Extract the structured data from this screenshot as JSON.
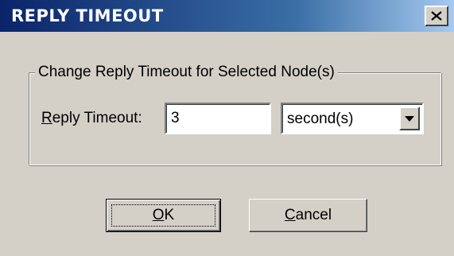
{
  "window": {
    "title": "REPLY TIMEOUT",
    "close_icon": "close-icon"
  },
  "group": {
    "legend": "Change Reply Timeout for Selected Node(s)"
  },
  "reply_timeout": {
    "label_mnemonic": "R",
    "label_rest": "eply Timeout:",
    "value": "3"
  },
  "unit_select": {
    "value": "second(s)",
    "arrow_icon": "dropdown-arrow-icon"
  },
  "buttons": {
    "ok_mnemonic": "O",
    "ok_rest": "K",
    "cancel_mnemonic": "C",
    "cancel_rest": "ancel"
  },
  "colors": {
    "title_gradient_start": "#0a246a",
    "title_gradient_end": "#a6caf0",
    "dialog_face": "#d4d0c8"
  }
}
